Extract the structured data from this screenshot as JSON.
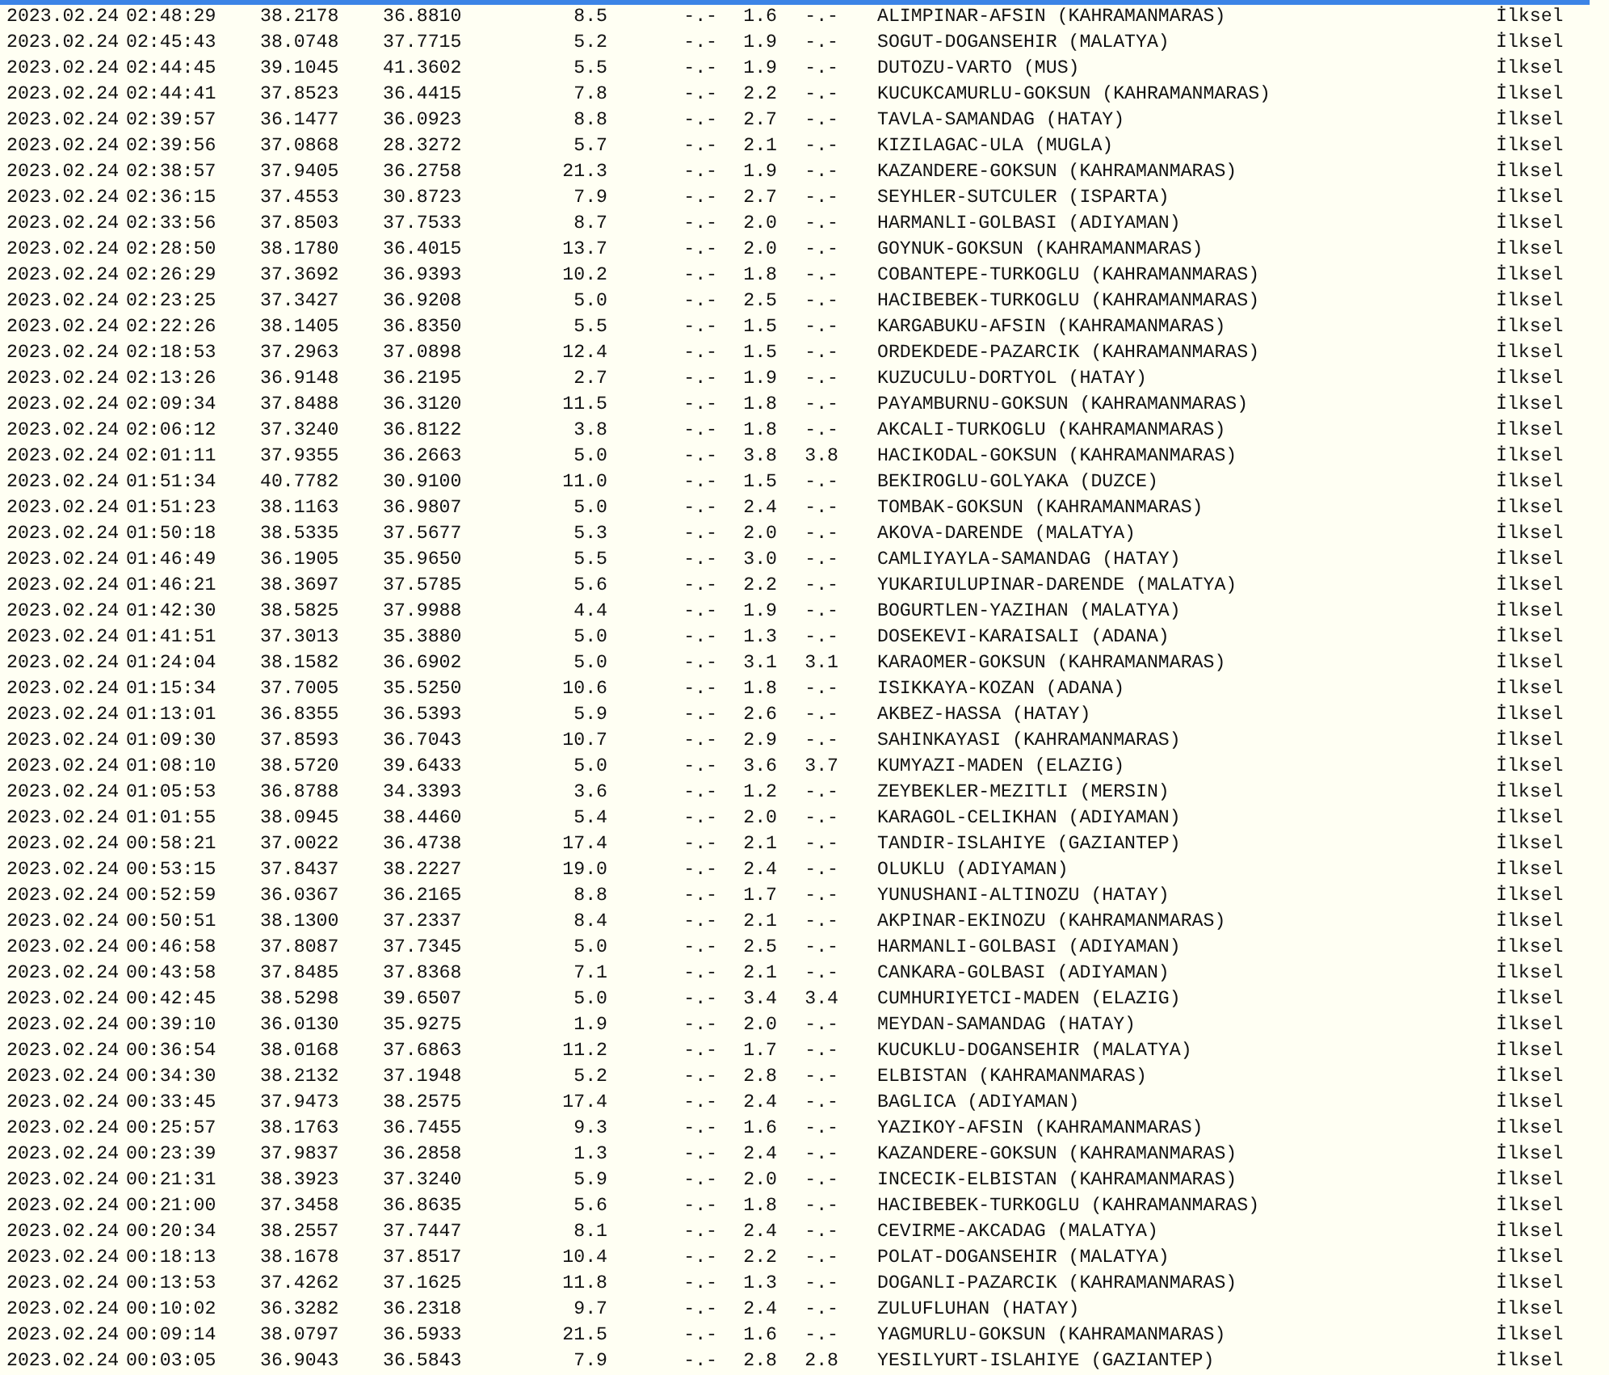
{
  "rows": [
    [
      "2023.02.24",
      "02:48:29",
      "38.2178",
      "36.8810",
      "8.5",
      "-.-",
      "1.6",
      "-.-",
      "ALIMPINAR-AFSIN (KAHRAMANMARAS)",
      "İlksel"
    ],
    [
      "2023.02.24",
      "02:45:43",
      "38.0748",
      "37.7715",
      "5.2",
      "-.-",
      "1.9",
      "-.-",
      "SOGUT-DOGANSEHIR (MALATYA)",
      "İlksel"
    ],
    [
      "2023.02.24",
      "02:44:45",
      "39.1045",
      "41.3602",
      "5.5",
      "-.-",
      "1.9",
      "-.-",
      "DUTOZU-VARTO (MUS)",
      "İlksel"
    ],
    [
      "2023.02.24",
      "02:44:41",
      "37.8523",
      "36.4415",
      "7.8",
      "-.-",
      "2.2",
      "-.-",
      "KUCUKCAMURLU-GOKSUN (KAHRAMANMARAS)",
      "İlksel"
    ],
    [
      "2023.02.24",
      "02:39:57",
      "36.1477",
      "36.0923",
      "8.8",
      "-.-",
      "2.7",
      "-.-",
      "TAVLA-SAMANDAG (HATAY)",
      "İlksel"
    ],
    [
      "2023.02.24",
      "02:39:56",
      "37.0868",
      "28.3272",
      "5.7",
      "-.-",
      "2.1",
      "-.-",
      "KIZILAGAC-ULA (MUGLA)",
      "İlksel"
    ],
    [
      "2023.02.24",
      "02:38:57",
      "37.9405",
      "36.2758",
      "21.3",
      "-.-",
      "1.9",
      "-.-",
      "KAZANDERE-GOKSUN (KAHRAMANMARAS)",
      "İlksel"
    ],
    [
      "2023.02.24",
      "02:36:15",
      "37.4553",
      "30.8723",
      "7.9",
      "-.-",
      "2.7",
      "-.-",
      "SEYHLER-SUTCULER (ISPARTA)",
      "İlksel"
    ],
    [
      "2023.02.24",
      "02:33:56",
      "37.8503",
      "37.7533",
      "8.7",
      "-.-",
      "2.0",
      "-.-",
      "HARMANLI-GOLBASI (ADIYAMAN)",
      "İlksel"
    ],
    [
      "2023.02.24",
      "02:28:50",
      "38.1780",
      "36.4015",
      "13.7",
      "-.-",
      "2.0",
      "-.-",
      "GOYNUK-GOKSUN (KAHRAMANMARAS)",
      "İlksel"
    ],
    [
      "2023.02.24",
      "02:26:29",
      "37.3692",
      "36.9393",
      "10.2",
      "-.-",
      "1.8",
      "-.-",
      "COBANTEPE-TURKOGLU (KAHRAMANMARAS)",
      "İlksel"
    ],
    [
      "2023.02.24",
      "02:23:25",
      "37.3427",
      "36.9208",
      "5.0",
      "-.-",
      "2.5",
      "-.-",
      "HACIBEBEK-TURKOGLU (KAHRAMANMARAS)",
      "İlksel"
    ],
    [
      "2023.02.24",
      "02:22:26",
      "38.1405",
      "36.8350",
      "5.5",
      "-.-",
      "1.5",
      "-.-",
      "KARGABUKU-AFSIN (KAHRAMANMARAS)",
      "İlksel"
    ],
    [
      "2023.02.24",
      "02:18:53",
      "37.2963",
      "37.0898",
      "12.4",
      "-.-",
      "1.5",
      "-.-",
      "ORDEKDEDE-PAZARCIK (KAHRAMANMARAS)",
      "İlksel"
    ],
    [
      "2023.02.24",
      "02:13:26",
      "36.9148",
      "36.2195",
      "2.7",
      "-.-",
      "1.9",
      "-.-",
      "KUZUCULU-DORTYOL (HATAY)",
      "İlksel"
    ],
    [
      "2023.02.24",
      "02:09:34",
      "37.8488",
      "36.3120",
      "11.5",
      "-.-",
      "1.8",
      "-.-",
      "PAYAMBURNU-GOKSUN (KAHRAMANMARAS)",
      "İlksel"
    ],
    [
      "2023.02.24",
      "02:06:12",
      "37.3240",
      "36.8122",
      "3.8",
      "-.-",
      "1.8",
      "-.-",
      "AKCALI-TURKOGLU (KAHRAMANMARAS)",
      "İlksel"
    ],
    [
      "2023.02.24",
      "02:01:11",
      "37.9355",
      "36.2663",
      "5.0",
      "-.-",
      "3.8",
      "3.8",
      "HACIKODAL-GOKSUN (KAHRAMANMARAS)",
      "İlksel"
    ],
    [
      "2023.02.24",
      "01:51:34",
      "40.7782",
      "30.9100",
      "11.0",
      "-.-",
      "1.5",
      "-.-",
      "BEKIROGLU-GOLYAKA (DUZCE)",
      "İlksel"
    ],
    [
      "2023.02.24",
      "01:51:23",
      "38.1163",
      "36.9807",
      "5.0",
      "-.-",
      "2.4",
      "-.-",
      "TOMBAK-GOKSUN (KAHRAMANMARAS)",
      "İlksel"
    ],
    [
      "2023.02.24",
      "01:50:18",
      "38.5335",
      "37.5677",
      "5.3",
      "-.-",
      "2.0",
      "-.-",
      "AKOVA-DARENDE (MALATYA)",
      "İlksel"
    ],
    [
      "2023.02.24",
      "01:46:49",
      "36.1905",
      "35.9650",
      "5.5",
      "-.-",
      "3.0",
      "-.-",
      "CAMLIYAYLA-SAMANDAG (HATAY)",
      "İlksel"
    ],
    [
      "2023.02.24",
      "01:46:21",
      "38.3697",
      "37.5785",
      "5.6",
      "-.-",
      "2.2",
      "-.-",
      "YUKARIULUPINAR-DARENDE (MALATYA)",
      "İlksel"
    ],
    [
      "2023.02.24",
      "01:42:30",
      "38.5825",
      "37.9988",
      "4.4",
      "-.-",
      "1.9",
      "-.-",
      "BOGURTLEN-YAZIHAN (MALATYA)",
      "İlksel"
    ],
    [
      "2023.02.24",
      "01:41:51",
      "37.3013",
      "35.3880",
      "5.0",
      "-.-",
      "1.3",
      "-.-",
      "DOSEKEVI-KARAISALI (ADANA)",
      "İlksel"
    ],
    [
      "2023.02.24",
      "01:24:04",
      "38.1582",
      "36.6902",
      "5.0",
      "-.-",
      "3.1",
      "3.1",
      "KARAOMER-GOKSUN (KAHRAMANMARAS)",
      "İlksel"
    ],
    [
      "2023.02.24",
      "01:15:34",
      "37.7005",
      "35.5250",
      "10.6",
      "-.-",
      "1.8",
      "-.-",
      "ISIKKAYA-KOZAN (ADANA)",
      "İlksel"
    ],
    [
      "2023.02.24",
      "01:13:01",
      "36.8355",
      "36.5393",
      "5.9",
      "-.-",
      "2.6",
      "-.-",
      "AKBEZ-HASSA (HATAY)",
      "İlksel"
    ],
    [
      "2023.02.24",
      "01:09:30",
      "37.8593",
      "36.7043",
      "10.7",
      "-.-",
      "2.9",
      "-.-",
      "SAHINKAYASI (KAHRAMANMARAS)",
      "İlksel"
    ],
    [
      "2023.02.24",
      "01:08:10",
      "38.5720",
      "39.6433",
      "5.0",
      "-.-",
      "3.6",
      "3.7",
      "KUMYAZI-MADEN (ELAZIG)",
      "İlksel"
    ],
    [
      "2023.02.24",
      "01:05:53",
      "36.8788",
      "34.3393",
      "3.6",
      "-.-",
      "1.2",
      "-.-",
      "ZEYBEKLER-MEZITLI (MERSIN)",
      "İlksel"
    ],
    [
      "2023.02.24",
      "01:01:55",
      "38.0945",
      "38.4460",
      "5.4",
      "-.-",
      "2.0",
      "-.-",
      "KARAGOL-CELIKHAN (ADIYAMAN)",
      "İlksel"
    ],
    [
      "2023.02.24",
      "00:58:21",
      "37.0022",
      "36.4738",
      "17.4",
      "-.-",
      "2.1",
      "-.-",
      "TANDIR-ISLAHIYE (GAZIANTEP)",
      "İlksel"
    ],
    [
      "2023.02.24",
      "00:53:15",
      "37.8437",
      "38.2227",
      "19.0",
      "-.-",
      "2.4",
      "-.-",
      "OLUKLU (ADIYAMAN)",
      "İlksel"
    ],
    [
      "2023.02.24",
      "00:52:59",
      "36.0367",
      "36.2165",
      "8.8",
      "-.-",
      "1.7",
      "-.-",
      "YUNUSHANI-ALTINOZU (HATAY)",
      "İlksel"
    ],
    [
      "2023.02.24",
      "00:50:51",
      "38.1300",
      "37.2337",
      "8.4",
      "-.-",
      "2.1",
      "-.-",
      "AKPINAR-EKINOZU (KAHRAMANMARAS)",
      "İlksel"
    ],
    [
      "2023.02.24",
      "00:46:58",
      "37.8087",
      "37.7345",
      "5.0",
      "-.-",
      "2.5",
      "-.-",
      "HARMANLI-GOLBASI (ADIYAMAN)",
      "İlksel"
    ],
    [
      "2023.02.24",
      "00:43:58",
      "37.8485",
      "37.8368",
      "7.1",
      "-.-",
      "2.1",
      "-.-",
      "CANKARA-GOLBASI (ADIYAMAN)",
      "İlksel"
    ],
    [
      "2023.02.24",
      "00:42:45",
      "38.5298",
      "39.6507",
      "5.0",
      "-.-",
      "3.4",
      "3.4",
      "CUMHURIYETCI-MADEN (ELAZIG)",
      "İlksel"
    ],
    [
      "2023.02.24",
      "00:39:10",
      "36.0130",
      "35.9275",
      "1.9",
      "-.-",
      "2.0",
      "-.-",
      "MEYDAN-SAMANDAG (HATAY)",
      "İlksel"
    ],
    [
      "2023.02.24",
      "00:36:54",
      "38.0168",
      "37.6863",
      "11.2",
      "-.-",
      "1.7",
      "-.-",
      "KUCUKLU-DOGANSEHIR (MALATYA)",
      "İlksel"
    ],
    [
      "2023.02.24",
      "00:34:30",
      "38.2132",
      "37.1948",
      "5.2",
      "-.-",
      "2.8",
      "-.-",
      "ELBISTAN (KAHRAMANMARAS)",
      "İlksel"
    ],
    [
      "2023.02.24",
      "00:33:45",
      "37.9473",
      "38.2575",
      "17.4",
      "-.-",
      "2.4",
      "-.-",
      "BAGLICA (ADIYAMAN)",
      "İlksel"
    ],
    [
      "2023.02.24",
      "00:25:57",
      "38.1763",
      "36.7455",
      "9.3",
      "-.-",
      "1.6",
      "-.-",
      "YAZIKOY-AFSIN (KAHRAMANMARAS)",
      "İlksel"
    ],
    [
      "2023.02.24",
      "00:23:39",
      "37.9837",
      "36.2858",
      "1.3",
      "-.-",
      "2.4",
      "-.-",
      "KAZANDERE-GOKSUN (KAHRAMANMARAS)",
      "İlksel"
    ],
    [
      "2023.02.24",
      "00:21:31",
      "38.3923",
      "37.3240",
      "5.9",
      "-.-",
      "2.0",
      "-.-",
      "INCECIK-ELBISTAN (KAHRAMANMARAS)",
      "İlksel"
    ],
    [
      "2023.02.24",
      "00:21:00",
      "37.3458",
      "36.8635",
      "5.6",
      "-.-",
      "1.8",
      "-.-",
      "HACIBEBEK-TURKOGLU (KAHRAMANMARAS)",
      "İlksel"
    ],
    [
      "2023.02.24",
      "00:20:34",
      "38.2557",
      "37.7447",
      "8.1",
      "-.-",
      "2.4",
      "-.-",
      "CEVIRME-AKCADAG (MALATYA)",
      "İlksel"
    ],
    [
      "2023.02.24",
      "00:18:13",
      "38.1678",
      "37.8517",
      "10.4",
      "-.-",
      "2.2",
      "-.-",
      "POLAT-DOGANSEHIR (MALATYA)",
      "İlksel"
    ],
    [
      "2023.02.24",
      "00:13:53",
      "37.4262",
      "37.1625",
      "11.8",
      "-.-",
      "1.3",
      "-.-",
      "DOGANLI-PAZARCIK (KAHRAMANMARAS)",
      "İlksel"
    ],
    [
      "2023.02.24",
      "00:10:02",
      "36.3282",
      "36.2318",
      "9.7",
      "-.-",
      "2.4",
      "-.-",
      "ZULUFLUHAN (HATAY)",
      "İlksel"
    ],
    [
      "2023.02.24",
      "00:09:14",
      "38.0797",
      "36.5933",
      "21.5",
      "-.-",
      "1.6",
      "-.-",
      "YAGMURLU-GOKSUN (KAHRAMANMARAS)",
      "İlksel"
    ],
    [
      "2023.02.24",
      "00:03:05",
      "36.9043",
      "36.5843",
      "7.9",
      "-.-",
      "2.8",
      "2.8",
      "YESILYURT-ISLAHIYE (GAZIANTEP)",
      "İlksel"
    ]
  ]
}
